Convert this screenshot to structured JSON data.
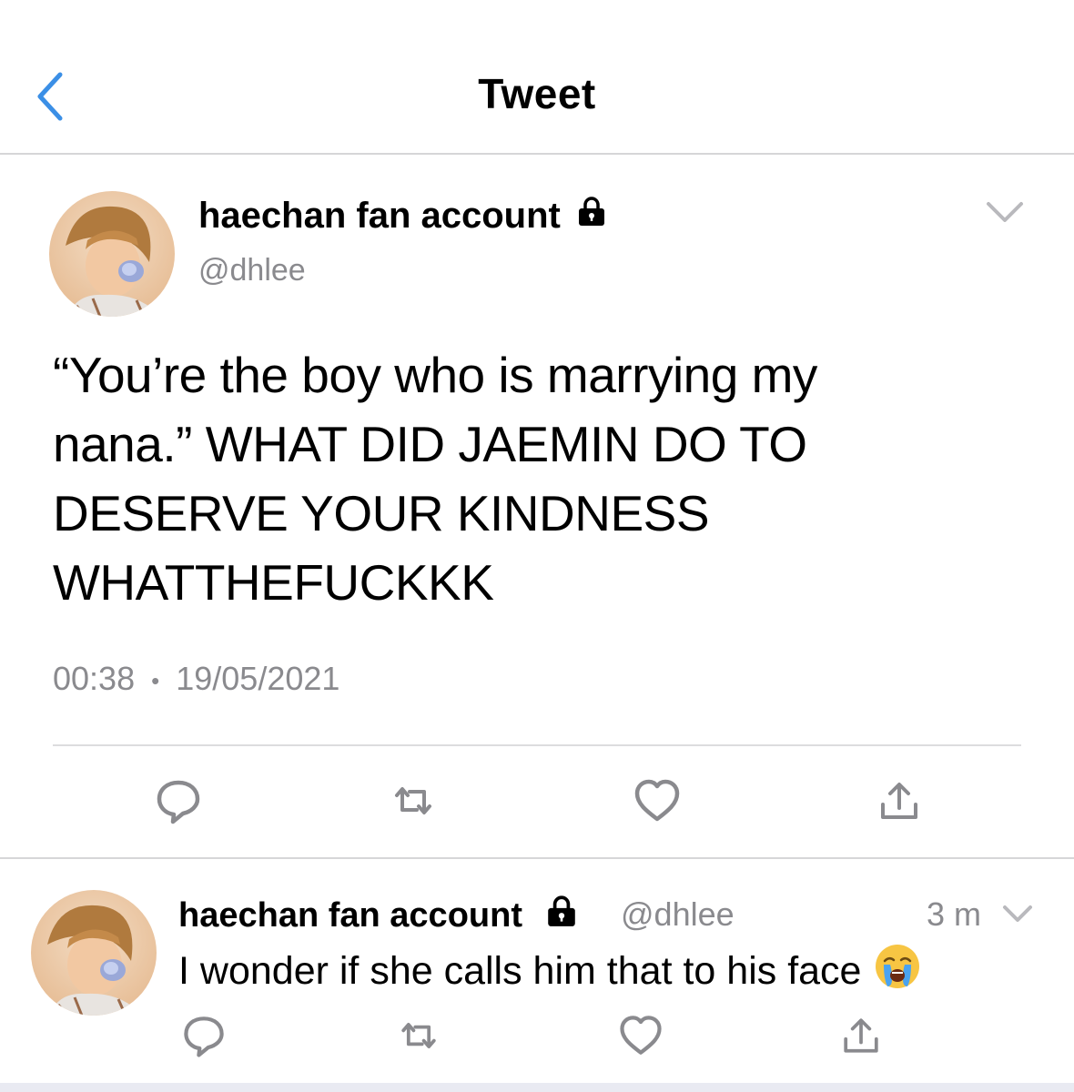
{
  "header": {
    "title": "Tweet",
    "back_icon": "chevron-left-icon"
  },
  "tweet": {
    "display_name": "haechan fan account",
    "locked_icon": "lock-icon",
    "handle": "@dhlee",
    "text_lines": [
      "“You’re the boy who is marrying my",
      "nana.” WHAT DID JAEMIN DO TO",
      "DESERVE YOUR KINDNESS",
      "WHATTHEFUCKKK"
    ],
    "time": "00:38",
    "separator": "•",
    "date": "19/05/2021",
    "actions": [
      "reply-icon",
      "retweet-icon",
      "like-icon",
      "share-icon"
    ]
  },
  "reply": {
    "display_name": "haechan fan account",
    "handle": "@dhlee",
    "time_ago": "3 m",
    "text": "I wonder if she calls him that to his face",
    "emoji": "crying-face-icon"
  },
  "colors": {
    "accent": "#1d9bf0",
    "secondary_text": "#8a8a8e",
    "divider": "#d6d6d8",
    "icon": "#8a8a8e"
  }
}
